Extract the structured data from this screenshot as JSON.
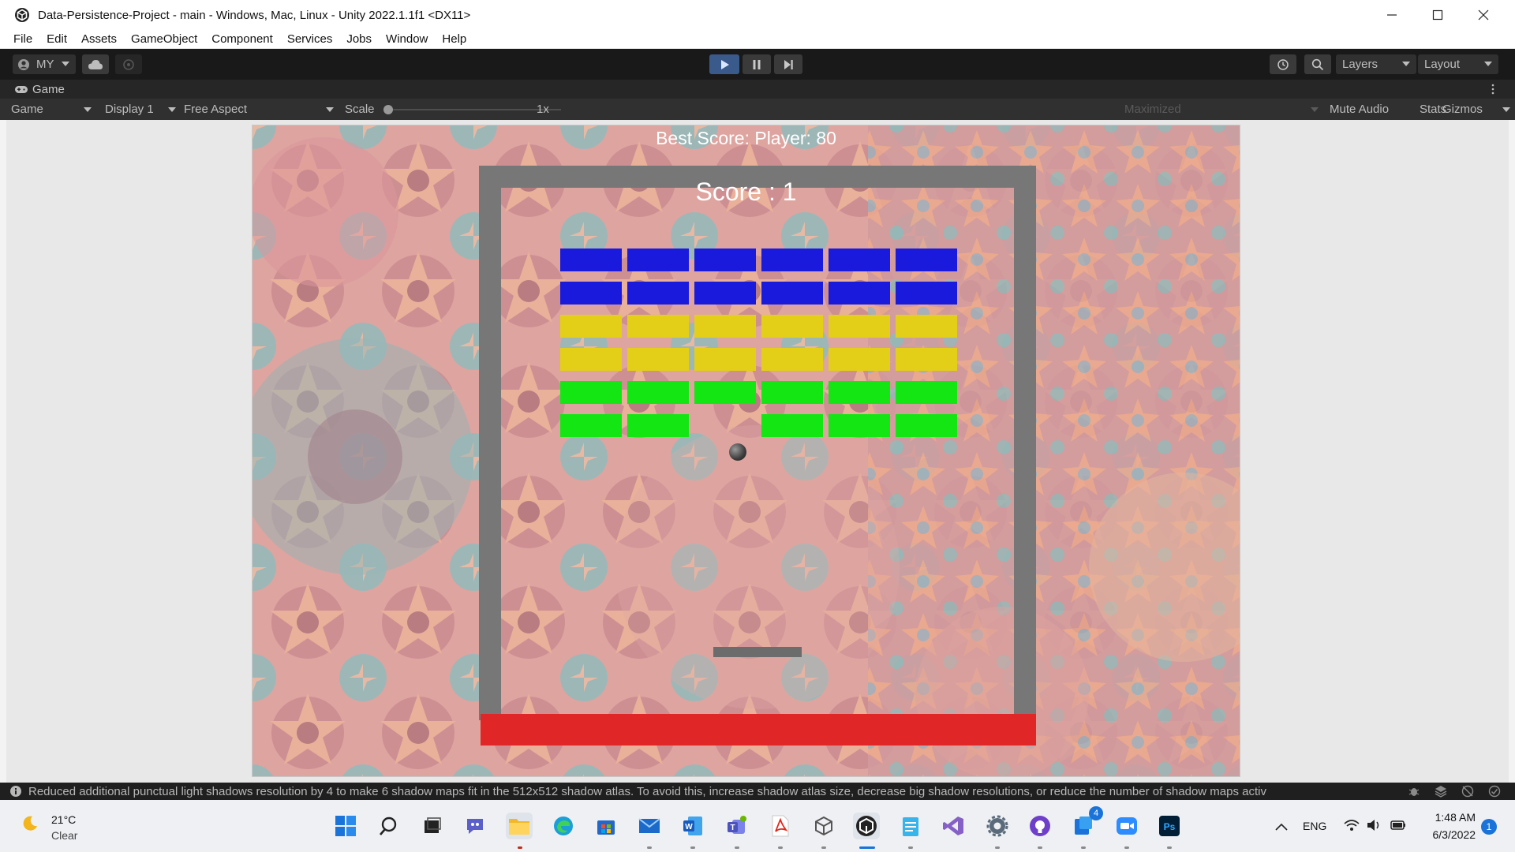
{
  "window": {
    "title": "Data-Persistence-Project - main - Windows, Mac, Linux - Unity 2022.1.1f1 <DX11>"
  },
  "menu": [
    "File",
    "Edit",
    "Assets",
    "GameObject",
    "Component",
    "Services",
    "Jobs",
    "Window",
    "Help"
  ],
  "toolbar": {
    "account": "MY",
    "layers": "Layers",
    "layout": "Layout"
  },
  "game_tab": {
    "title": "Game",
    "mode": "Game",
    "display": "Display 1",
    "aspect": "Free Aspect",
    "scale_label": "Scale",
    "scale_value": "1x",
    "maximized": "Maximized",
    "mute_audio": "Mute Audio",
    "stats": "Stats",
    "gizmos": "Gizmos"
  },
  "game": {
    "best_score": "Best Score: Player: 80",
    "score": "Score : 1",
    "brick_colors": [
      "#1a1adc",
      "#1a1adc",
      "#e3cf17",
      "#e3cf17",
      "#14e614",
      "#14e614"
    ],
    "columns": 6,
    "rows": 6,
    "missing_bricks": [
      [
        5,
        2
      ]
    ],
    "wall_color": "#777777",
    "deadzone_color": "#e02626"
  },
  "status": {
    "message": "Reduced additional punctual light shadows resolution by 4 to make 6 shadow maps fit in the 512x512 shadow atlas. To avoid this, increase shadow atlas size, decrease big shadow resolutions, or reduce the number of shadow maps activ"
  },
  "taskbar": {
    "weather_temp": "21°C",
    "weather_desc": "Clear",
    "language": "ENG",
    "time": "1:48 AM",
    "date": "6/3/2022",
    "notification_count": "1",
    "teams_badge": "4"
  }
}
